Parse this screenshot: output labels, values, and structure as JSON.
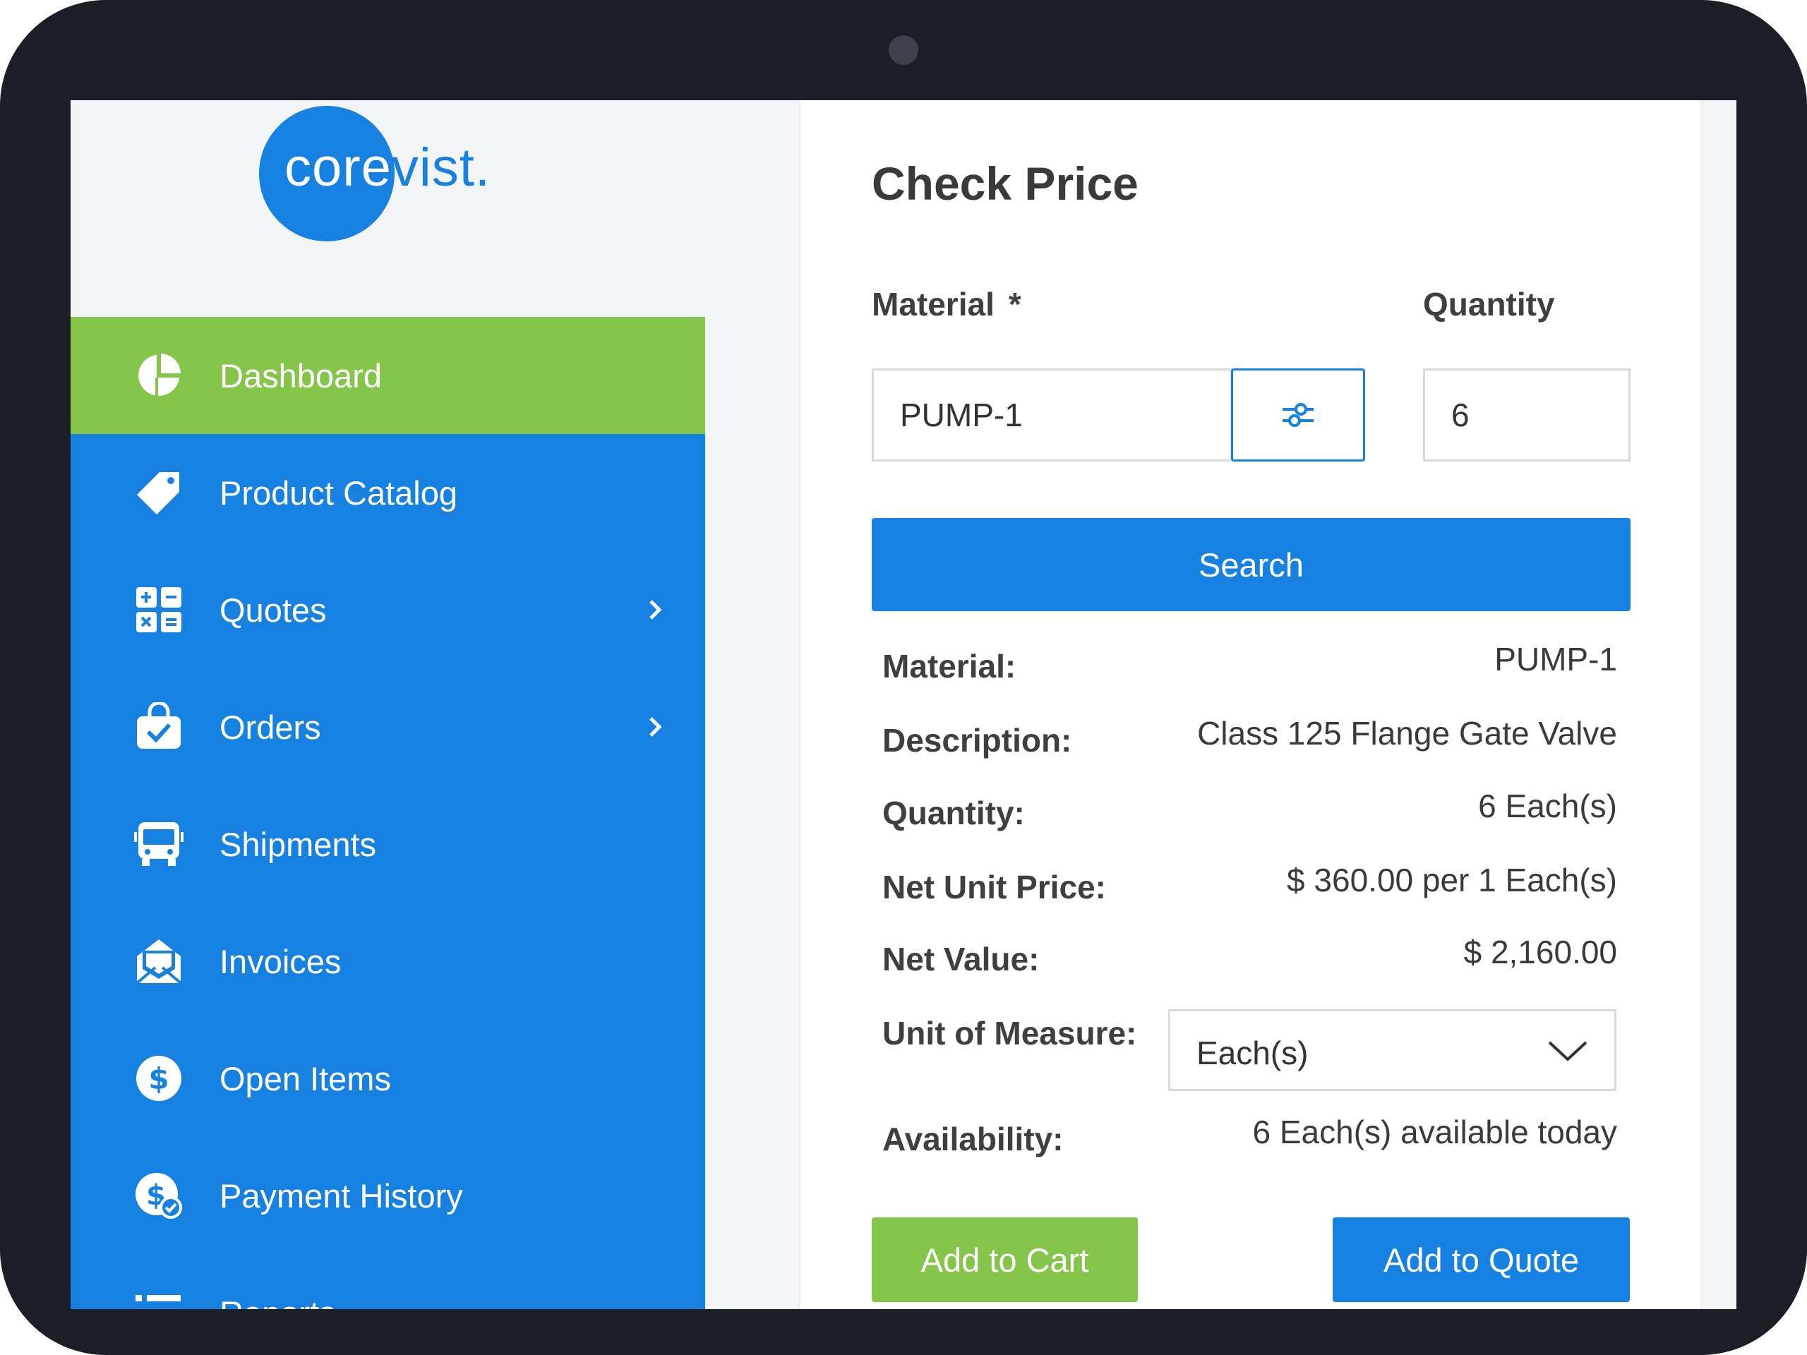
{
  "logo": {
    "part1": "core",
    "part2": "vist",
    "part3": "."
  },
  "sidebar": {
    "items": [
      {
        "label": "Dashboard",
        "icon": "pie-chart-icon",
        "active": true
      },
      {
        "label": "Product Catalog",
        "icon": "tag-icon"
      },
      {
        "label": "Quotes",
        "icon": "grid-calculator-icon",
        "has_chevron": true
      },
      {
        "label": "Orders",
        "icon": "shopping-bag-check-icon",
        "has_chevron": true
      },
      {
        "label": "Shipments",
        "icon": "bus-icon"
      },
      {
        "label": "Invoices",
        "icon": "envelope-icon"
      },
      {
        "label": "Open Items",
        "icon": "dollar-circle-icon"
      },
      {
        "label": "Payment History",
        "icon": "dollar-check-icon"
      },
      {
        "label": "Reports",
        "icon": "list-icon"
      }
    ]
  },
  "check_price": {
    "title": "Check Price",
    "material_label": "Material",
    "required_mark": "*",
    "quantity_label": "Quantity",
    "material_value": "PUMP-1",
    "quantity_value": "6",
    "search_label": "Search"
  },
  "results": {
    "material_label": "Material:",
    "material_value": "PUMP-1",
    "description_label": "Description:",
    "description_value": "Class 125 Flange Gate Valve",
    "quantity_label": "Quantity:",
    "quantity_value": "6 Each(s)",
    "net_unit_price_label": "Net Unit Price:",
    "net_unit_price_value": "$ 360.00 per 1 Each(s)",
    "net_value_label": "Net Value:",
    "net_value_value": "$ 2,160.00",
    "uom_label": "Unit of Measure:",
    "uom_value": "Each(s)",
    "availability_label": "Availability:",
    "availability_value": "6 Each(s) available today"
  },
  "actions": {
    "add_to_cart": "Add to Cart",
    "add_to_quote": "Add to Quote"
  },
  "colors": {
    "primary": "#1781e2",
    "accent_green": "#84c54a",
    "bezel": "#1b1e27"
  }
}
